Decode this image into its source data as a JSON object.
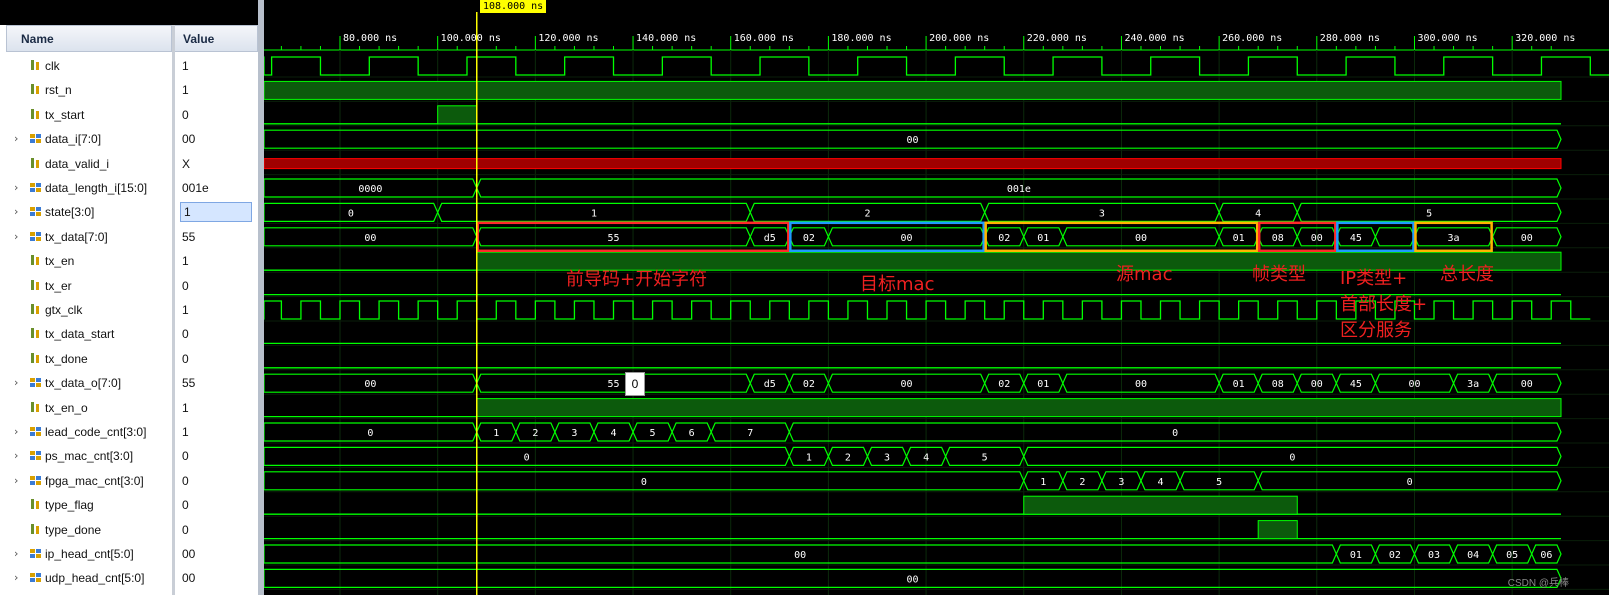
{
  "panel": {
    "name_header": "Name",
    "value_header": "Value"
  },
  "cursor_label": "108.000 ns",
  "time_ticks": [
    "80.000 ns",
    "100.000 ns",
    "120.000 ns",
    "140.000 ns",
    "160.000 ns",
    "180.000 ns",
    "200.000 ns",
    "220.000 ns",
    "240.000 ns",
    "260.000 ns",
    "280.000 ns",
    "300.000 ns",
    "320.000 ns"
  ],
  "signals": [
    {
      "name": "clk",
      "value": "1",
      "bus": false,
      "kind": "clk",
      "period": 20,
      "phase": 6
    },
    {
      "name": "rst_n",
      "value": "1",
      "bus": false,
      "kind": "high"
    },
    {
      "name": "tx_start",
      "value": "0",
      "bus": false,
      "kind": "pulse",
      "t0": 100,
      "t1": 108
    },
    {
      "name": "data_i[7:0]",
      "value": "00",
      "bus": true,
      "kind": "bus",
      "segs": [
        [
          60,
          330,
          "00"
        ]
      ]
    },
    {
      "name": "data_valid_i",
      "value": "X",
      "bus": false,
      "kind": "x"
    },
    {
      "name": "data_length_i[15:0]",
      "value": "001e",
      "bus": true,
      "kind": "bus",
      "segs": [
        [
          60,
          108,
          "0000"
        ],
        [
          108,
          330,
          "001e"
        ]
      ]
    },
    {
      "name": "state[3:0]",
      "value": "1",
      "bus": true,
      "kind": "bus",
      "segs": [
        [
          60,
          100,
          "0"
        ],
        [
          100,
          164,
          "1"
        ],
        [
          164,
          212,
          "2"
        ],
        [
          212,
          260,
          "3"
        ],
        [
          260,
          276,
          "4"
        ],
        [
          276,
          330,
          "5"
        ]
      ]
    },
    {
      "name": "tx_data[7:0]",
      "value": "55",
      "bus": true,
      "kind": "bus",
      "segs": [
        [
          60,
          108,
          "00"
        ],
        [
          108,
          164,
          "55"
        ],
        [
          164,
          172,
          "d5"
        ],
        [
          172,
          180,
          "02"
        ],
        [
          180,
          212,
          "00"
        ],
        [
          212,
          220,
          "02"
        ],
        [
          220,
          228,
          "01"
        ],
        [
          228,
          260,
          "00"
        ],
        [
          260,
          268,
          "01"
        ],
        [
          268,
          276,
          "08"
        ],
        [
          276,
          284,
          "00"
        ],
        [
          284,
          292,
          "45"
        ],
        [
          292,
          300,
          ""
        ],
        [
          300,
          316,
          "3a"
        ],
        [
          316,
          330,
          "00"
        ]
      ]
    },
    {
      "name": "tx_en",
      "value": "1",
      "bus": false,
      "kind": "highfrom",
      "t0": 108
    },
    {
      "name": "tx_er",
      "value": "0",
      "bus": false,
      "kind": "low"
    },
    {
      "name": "gtx_clk",
      "value": "1",
      "bus": false,
      "kind": "clk",
      "period": 8,
      "phase": 0
    },
    {
      "name": "tx_data_start",
      "value": "0",
      "bus": false,
      "kind": "low"
    },
    {
      "name": "tx_done",
      "value": "0",
      "bus": false,
      "kind": "low"
    },
    {
      "name": "tx_data_o[7:0]",
      "value": "55",
      "bus": true,
      "kind": "bus",
      "segs": [
        [
          60,
          108,
          "00"
        ],
        [
          108,
          164,
          "55"
        ],
        [
          164,
          172,
          "d5"
        ],
        [
          172,
          180,
          "02"
        ],
        [
          180,
          212,
          "00"
        ],
        [
          212,
          220,
          "02"
        ],
        [
          220,
          228,
          "01"
        ],
        [
          228,
          260,
          "00"
        ],
        [
          260,
          268,
          "01"
        ],
        [
          268,
          276,
          "08"
        ],
        [
          276,
          284,
          "00"
        ],
        [
          284,
          292,
          "45"
        ],
        [
          292,
          308,
          "00"
        ],
        [
          308,
          316,
          "3a"
        ],
        [
          316,
          330,
          "00"
        ]
      ]
    },
    {
      "name": "tx_en_o",
      "value": "1",
      "bus": false,
      "kind": "highfrom",
      "t0": 108
    },
    {
      "name": "lead_code_cnt[3:0]",
      "value": "1",
      "bus": true,
      "kind": "bus",
      "segs": [
        [
          60,
          108,
          "0"
        ],
        [
          108,
          116,
          "1"
        ],
        [
          116,
          124,
          "2"
        ],
        [
          124,
          132,
          "3"
        ],
        [
          132,
          140,
          "4"
        ],
        [
          140,
          148,
          "5"
        ],
        [
          148,
          156,
          "6"
        ],
        [
          156,
          172,
          "7"
        ],
        [
          172,
          330,
          "0"
        ]
      ]
    },
    {
      "name": "ps_mac_cnt[3:0]",
      "value": "0",
      "bus": true,
      "kind": "bus",
      "segs": [
        [
          60,
          172,
          "0"
        ],
        [
          172,
          180,
          "1"
        ],
        [
          180,
          188,
          "2"
        ],
        [
          188,
          196,
          "3"
        ],
        [
          196,
          204,
          "4"
        ],
        [
          204,
          220,
          "5"
        ],
        [
          220,
          330,
          "0"
        ]
      ]
    },
    {
      "name": "fpga_mac_cnt[3:0]",
      "value": "0",
      "bus": true,
      "kind": "bus",
      "segs": [
        [
          60,
          220,
          "0"
        ],
        [
          220,
          228,
          "1"
        ],
        [
          228,
          236,
          "2"
        ],
        [
          236,
          244,
          "3"
        ],
        [
          244,
          252,
          "4"
        ],
        [
          252,
          268,
          "5"
        ],
        [
          268,
          330,
          "0"
        ]
      ]
    },
    {
      "name": "type_flag",
      "value": "0",
      "bus": false,
      "kind": "pulse",
      "t0": 220,
      "t1": 276
    },
    {
      "name": "type_done",
      "value": "0",
      "bus": false,
      "kind": "pulse",
      "t0": 268,
      "t1": 276
    },
    {
      "name": "ip_head_cnt[5:0]",
      "value": "00",
      "bus": true,
      "kind": "bus",
      "segs": [
        [
          60,
          284,
          "00"
        ],
        [
          284,
          292,
          "01"
        ],
        [
          292,
          300,
          "02"
        ],
        [
          300,
          308,
          "03"
        ],
        [
          308,
          316,
          "04"
        ],
        [
          316,
          324,
          "05"
        ],
        [
          324,
          330,
          "06"
        ]
      ]
    },
    {
      "name": "udp_head_cnt[5:0]",
      "value": "00",
      "bus": true,
      "kind": "bus",
      "segs": [
        [
          60,
          330,
          "00"
        ]
      ]
    }
  ],
  "annotations": [
    {
      "text": "前导码+开始字符",
      "color": "#e02020"
    },
    {
      "text": "目标mac",
      "color": "#1e90ff"
    },
    {
      "text": "源mac",
      "color": "#f0b400"
    },
    {
      "text": "帧类型",
      "color": "#e02020"
    },
    {
      "text": "IP类型+\n首部长度+\n区分服务",
      "color": "#1e90ff"
    },
    {
      "text": "总长度",
      "color": "#f0b400"
    }
  ],
  "tooltip_value": "0",
  "watermark": "CSDN @兵棒",
  "colors": {
    "wave": "#00ff00",
    "grid": "#003300",
    "cursor": "#ffff00",
    "x": "#ff0000"
  }
}
